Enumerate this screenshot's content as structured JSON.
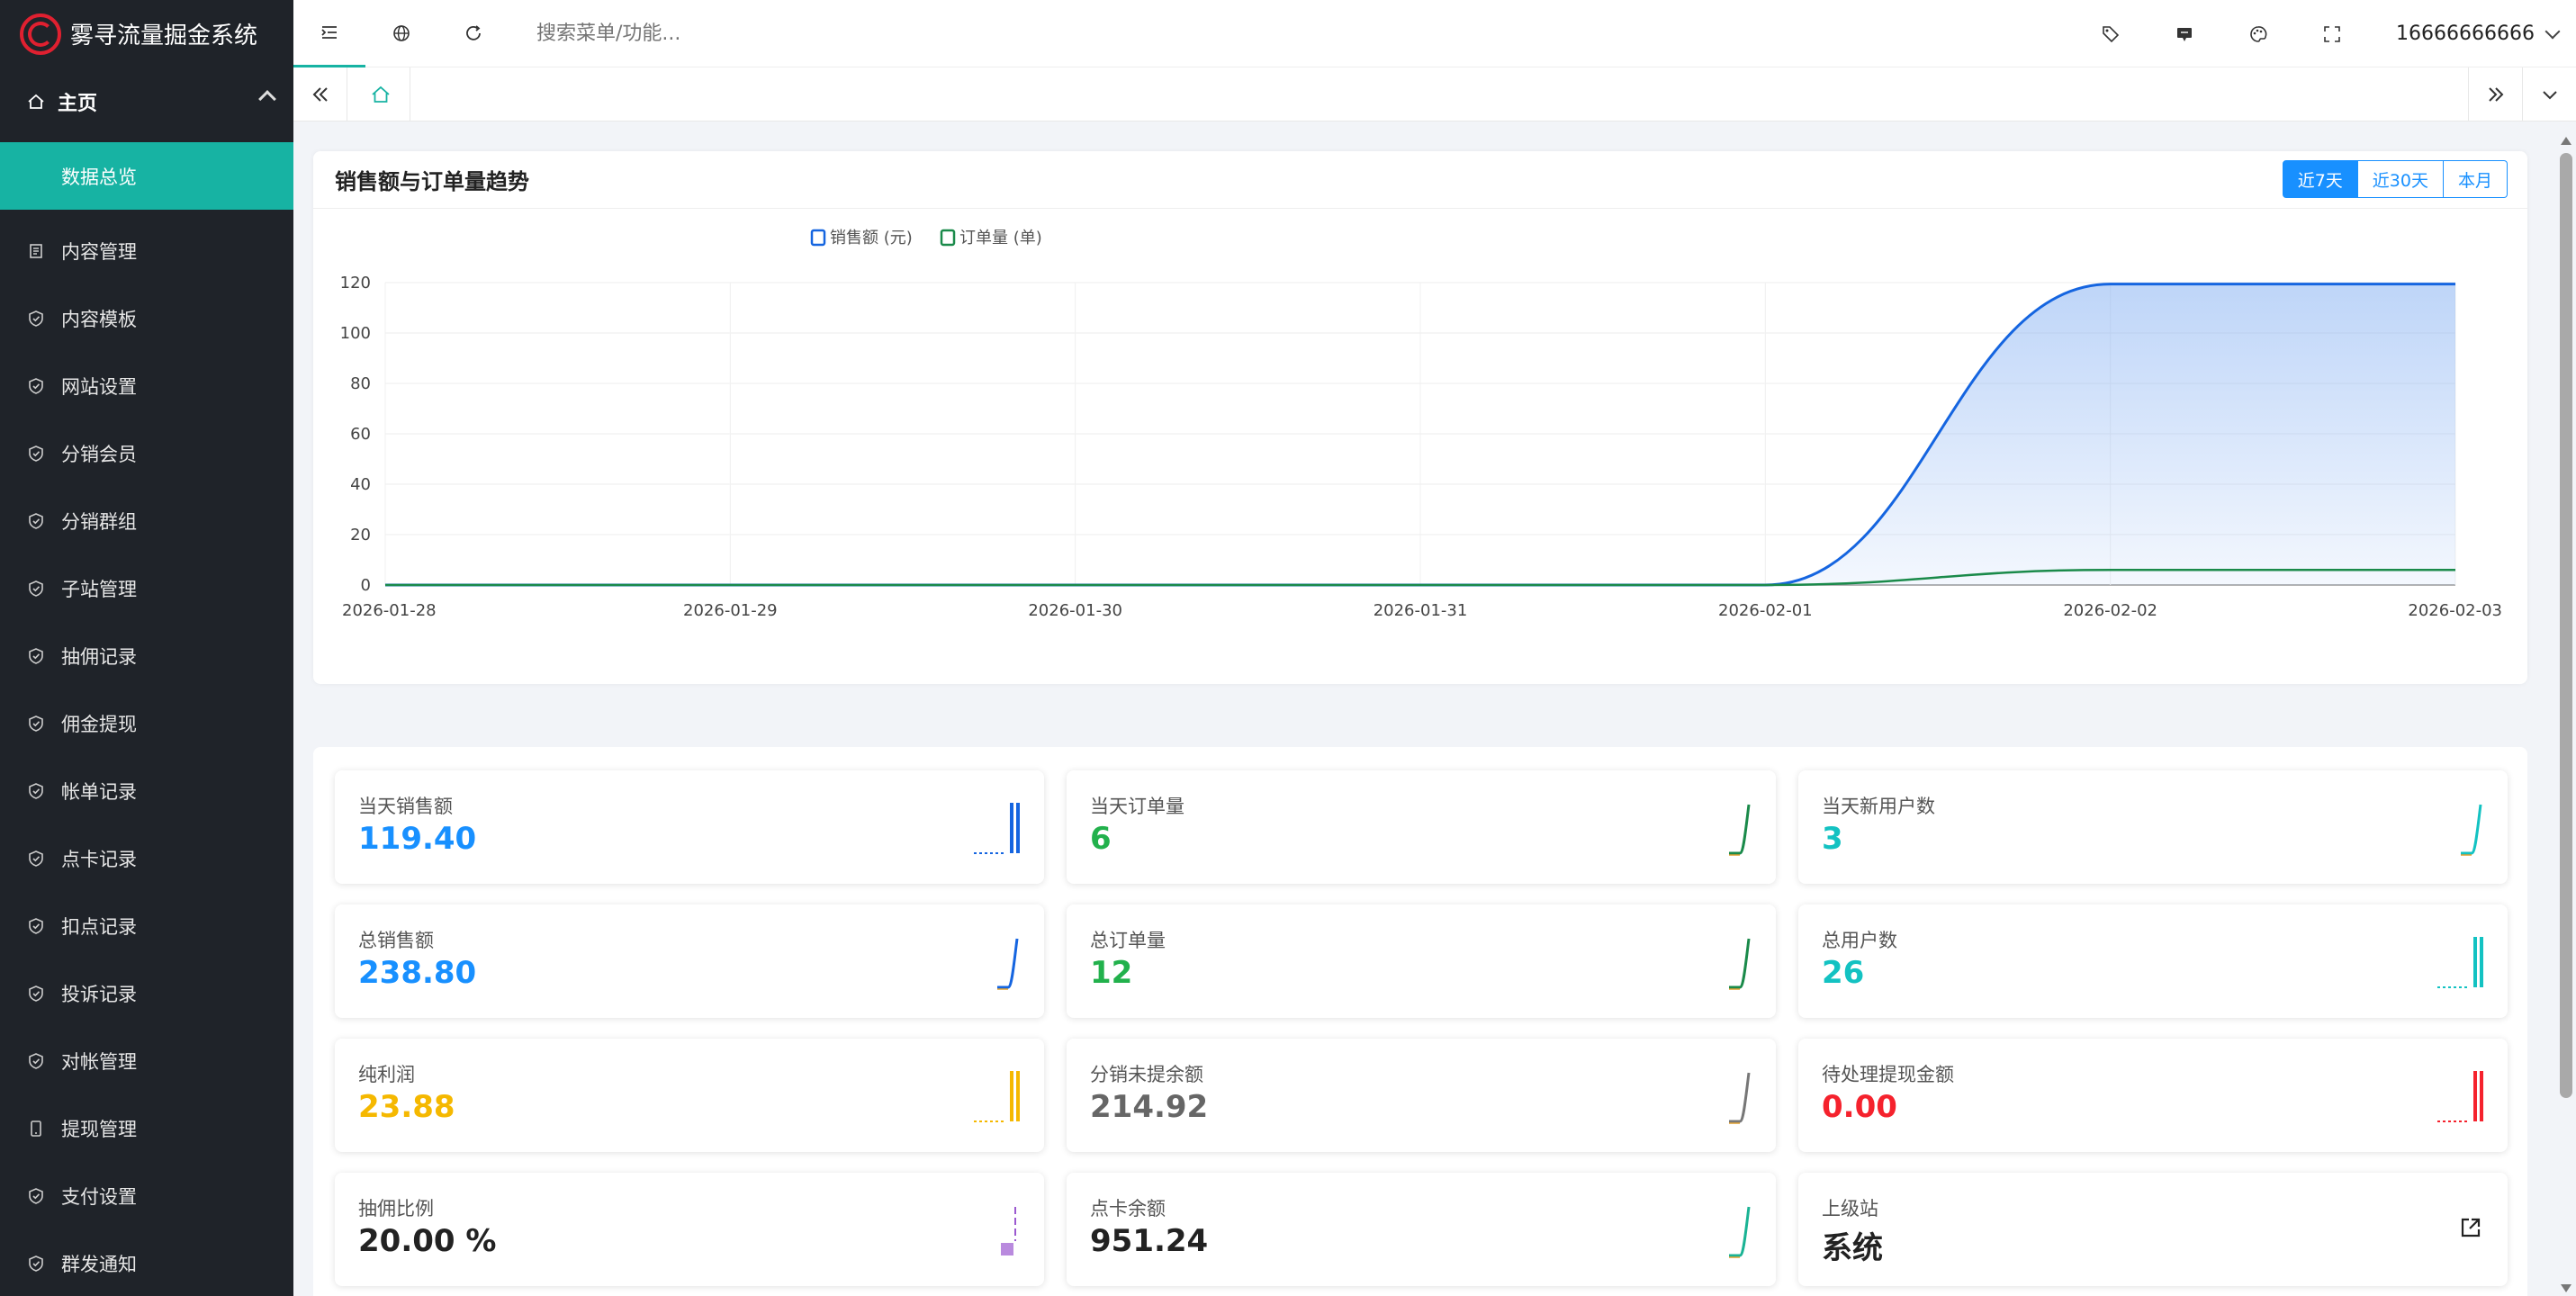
{
  "app": {
    "title": "雾寻流量掘金系统"
  },
  "sidebar": {
    "group": "主页",
    "active_item": "数据总览",
    "items": [
      {
        "label": "内容管理",
        "icon": "document-icon"
      },
      {
        "label": "内容模板",
        "icon": "shield-check-icon"
      },
      {
        "label": "网站设置",
        "icon": "shield-check-icon"
      },
      {
        "label": "分销会员",
        "icon": "shield-check-icon"
      },
      {
        "label": "分销群组",
        "icon": "shield-check-icon"
      },
      {
        "label": "子站管理",
        "icon": "shield-check-icon"
      },
      {
        "label": "抽佣记录",
        "icon": "shield-check-icon"
      },
      {
        "label": "佣金提现",
        "icon": "shield-check-icon"
      },
      {
        "label": "帐单记录",
        "icon": "shield-check-icon"
      },
      {
        "label": "点卡记录",
        "icon": "shield-check-icon"
      },
      {
        "label": "扣点记录",
        "icon": "shield-check-icon"
      },
      {
        "label": "投诉记录",
        "icon": "shield-check-icon"
      },
      {
        "label": "对帐管理",
        "icon": "shield-check-icon"
      },
      {
        "label": "提现管理",
        "icon": "phone-icon"
      },
      {
        "label": "支付设置",
        "icon": "shield-check-icon"
      },
      {
        "label": "群发通知",
        "icon": "shield-check-icon"
      }
    ]
  },
  "topbar": {
    "search_placeholder": "搜索菜单/功能...",
    "user": "16666666666"
  },
  "chart_card": {
    "title": "销售额与订单量趋势",
    "ranges": [
      "近7天",
      "近30天",
      "本月"
    ],
    "active_range": "近7天"
  },
  "chart_data": {
    "type": "area",
    "x": [
      "2026-01-28",
      "2026-01-29",
      "2026-01-30",
      "2026-01-31",
      "2026-02-01",
      "2026-02-02",
      "2026-02-03"
    ],
    "series": [
      {
        "name": "销售额 (元)",
        "values": [
          0,
          0,
          0,
          0,
          0,
          119.4,
          119.4
        ],
        "color": "#1565e0"
      },
      {
        "name": "订单量 (单)",
        "values": [
          0,
          0,
          0,
          0,
          0,
          6,
          6
        ],
        "color": "#1a8a4a"
      }
    ],
    "ylim": [
      0,
      120
    ],
    "yticks": [
      0,
      20,
      40,
      60,
      80,
      100,
      120
    ],
    "grid": true,
    "legend": "top-center"
  },
  "stats": [
    {
      "label": "当天销售额",
      "value": "119.40",
      "color": "#1890ff",
      "spark": "bars",
      "spark_color": "#1565e0"
    },
    {
      "label": "当天订单量",
      "value": "6",
      "color": "#22b14c",
      "spark": "step",
      "spark_color": "#1a8a4a"
    },
    {
      "label": "当天新用户数",
      "value": "3",
      "color": "#13c2c2",
      "spark": "step",
      "spark_color": "#13c2c2"
    },
    {
      "label": "总销售额",
      "value": "238.80",
      "color": "#1890ff",
      "spark": "step",
      "spark_color": "#1565e0"
    },
    {
      "label": "总订单量",
      "value": "12",
      "color": "#22b14c",
      "spark": "step",
      "spark_color": "#1a8a4a"
    },
    {
      "label": "总用户数",
      "value": "26",
      "color": "#13c2c2",
      "spark": "bars",
      "spark_color": "#13c2c2"
    },
    {
      "label": "纯利润",
      "value": "23.88",
      "color": "#f5b800",
      "spark": "bars",
      "spark_color": "#f5b800"
    },
    {
      "label": "分销未提余额",
      "value": "214.92",
      "color": "#666666",
      "spark": "step",
      "spark_color": "#777777"
    },
    {
      "label": "待处理提现金额",
      "value": "0.00",
      "color": "#f5222d",
      "spark": "bars",
      "spark_color": "#f5222d"
    },
    {
      "label": "抽佣比例",
      "value": "20.00 %",
      "color": "#222222",
      "spark": "purple",
      "spark_color": "#9b59d0"
    },
    {
      "label": "点卡余额",
      "value": "951.24",
      "color": "#222222",
      "spark": "step",
      "spark_color": "#1ab394"
    },
    {
      "label": "上级站",
      "value": "系统",
      "color": "#222222",
      "spark": "external-link-icon",
      "spark_color": "#222222"
    }
  ]
}
